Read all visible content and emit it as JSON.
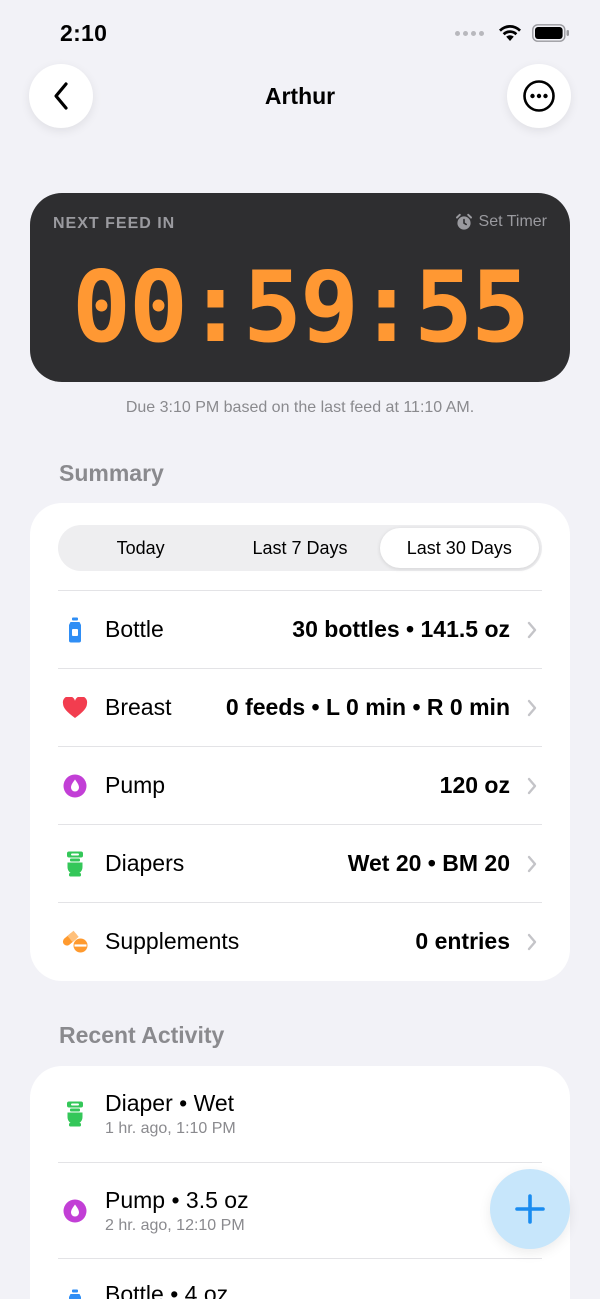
{
  "status_bar": {
    "time": "2:10"
  },
  "nav": {
    "title": "Arthur"
  },
  "timer": {
    "label": "NEXT FEED IN",
    "set_timer_label": "Set Timer",
    "value": "00:59:55",
    "due_text": "Due 3:10 PM based on the last feed at 11:10 AM."
  },
  "summary": {
    "title": "Summary",
    "tabs": [
      {
        "label": "Today",
        "active": false
      },
      {
        "label": "Last 7 Days",
        "active": false
      },
      {
        "label": "Last 30 Days",
        "active": true
      }
    ],
    "rows": [
      {
        "label": "Bottle",
        "value": "30 bottles • 141.5 oz",
        "icon": "bottle-icon",
        "color": "#2f8ef5"
      },
      {
        "label": "Breast",
        "value": "0 feeds • L 0 min • R 0 min",
        "icon": "heart-icon",
        "color": "#f23d4f"
      },
      {
        "label": "Pump",
        "value": "120 oz",
        "icon": "drop-icon",
        "color": "#c23fd6"
      },
      {
        "label": "Diapers",
        "value": "Wet 20 • BM 20",
        "icon": "diaper-icon",
        "color": "#34c759"
      },
      {
        "label": "Supplements",
        "value": "0 entries",
        "icon": "pills-icon",
        "color": "#ff9a2e"
      }
    ]
  },
  "recent": {
    "title": "Recent Activity",
    "items": [
      {
        "title": "Diaper • Wet",
        "time": "1 hr. ago, 1:10 PM",
        "icon": "diaper-icon"
      },
      {
        "title": "Pump • 3.5 oz",
        "time": "2 hr. ago, 12:10 PM",
        "icon": "drop-icon"
      },
      {
        "title": "Bottle • 4 oz",
        "time": "",
        "icon": "bottle-icon"
      }
    ]
  },
  "colors": {
    "accent": "#ff9833",
    "fab": "#1a8cf0",
    "background": "#f2f2f7"
  }
}
